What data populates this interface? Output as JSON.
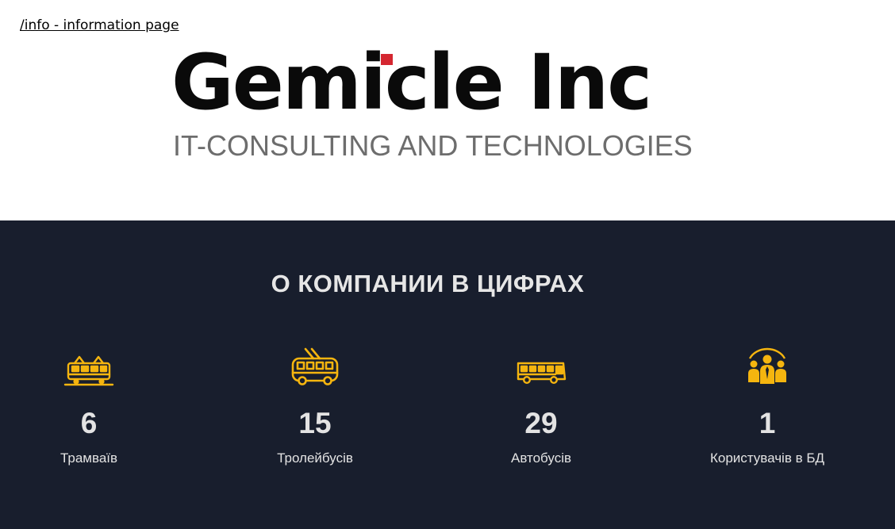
{
  "header": {
    "info_link": "/info - information page"
  },
  "logo": {
    "name": "Gemicle Inc",
    "tagline": "IT-CONSULTING AND TECHNOLOGIES",
    "brand_color": "#0a0a0a",
    "accent_color": "#d42630",
    "tagline_color": "#6d6d6d"
  },
  "stats": {
    "title": "О КОМПАНИИ В ЦИФРАХ",
    "background": "#181e2d",
    "icon_color": "#f5b50f",
    "items": [
      {
        "icon": "tram-icon",
        "number": "6",
        "label": "Трамваїв"
      },
      {
        "icon": "trolleybus-icon",
        "number": "15",
        "label": "Тролейбусів"
      },
      {
        "icon": "bus-icon",
        "number": "29",
        "label": "Автобусів"
      },
      {
        "icon": "users-icon",
        "number": "1",
        "label": "Користувачів в БД"
      }
    ]
  }
}
